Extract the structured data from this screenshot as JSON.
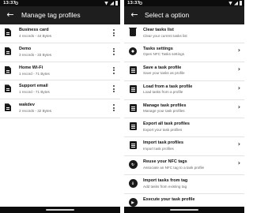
{
  "left_screen": {
    "status": {
      "time": "13:37"
    },
    "appbar": {
      "title": "Manage tag profiles"
    },
    "profiles": [
      {
        "name": "Business card",
        "info": "4 records - 44 Bytes"
      },
      {
        "name": "Demo",
        "info": "3 records - 33 Bytes"
      },
      {
        "name": "Home Wi-Fi",
        "info": "1 record - 71 Bytes"
      },
      {
        "name": "Support email",
        "info": "1 record - 71 Bytes"
      },
      {
        "name": "wakdev",
        "info": "2 records - 32 Bytes"
      }
    ]
  },
  "right_screen": {
    "status": {
      "time": "13:37"
    },
    "appbar": {
      "title": "Select a option"
    },
    "options": [
      {
        "icon": "trash-icon",
        "title": "Clear tasks list",
        "subtitle": "Clear your current tasks list"
      },
      {
        "icon": "gear-icon",
        "title": "Tasks settings",
        "subtitle": "Open NFC Tasks settings"
      },
      {
        "icon": "save-icon",
        "title": "Save a task profile",
        "subtitle": "Save your tasks as profile"
      },
      {
        "icon": "load-icon",
        "title": "Load from a task profile",
        "subtitle": "Load tasks from a profile"
      },
      {
        "icon": "manage-icon",
        "title": "Manage task profiles",
        "subtitle": "Manage your task profiles"
      },
      {
        "icon": "export-icon",
        "title": "Export all task profiles",
        "subtitle": "Export your task profiles"
      },
      {
        "icon": "import-icon",
        "title": "Import task profiles",
        "subtitle": "Import task profiles"
      },
      {
        "icon": "reuse-nfc-icon",
        "title": "Reuse your NFC tags",
        "subtitle": "Associate an NFC tag to a task profile"
      },
      {
        "icon": "import-tag-icon",
        "title": "Import tasks from tag",
        "subtitle": "Add tasks from existing tag"
      },
      {
        "icon": "execute-icon",
        "title": "Execute your task profile",
        "subtitle": ""
      }
    ]
  }
}
